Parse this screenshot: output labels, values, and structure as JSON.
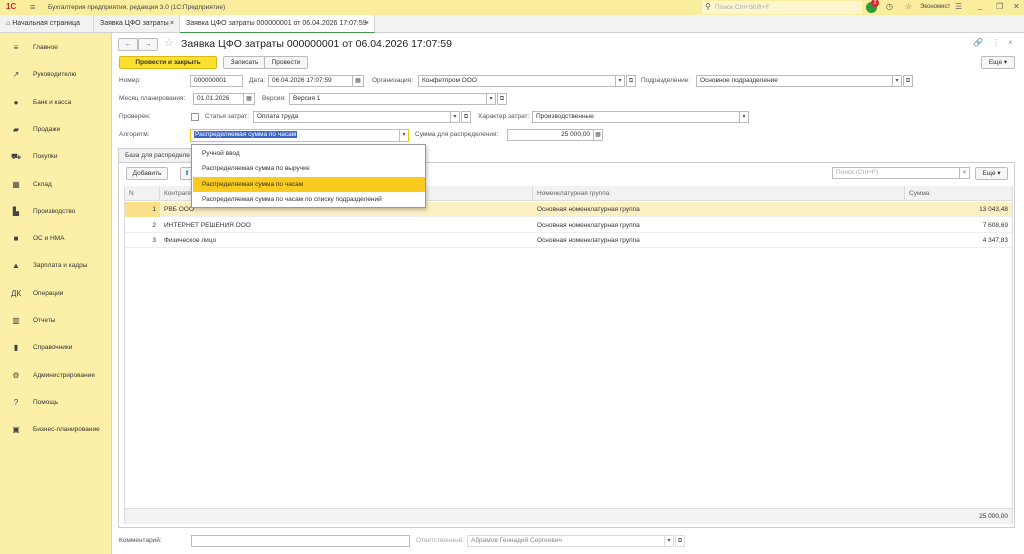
{
  "app": {
    "title": "Бухгалтерия предприятия, редакция 3.0  (1С:Предприятие)",
    "search_placeholder": "Поиск Ctrl+Shift+F",
    "notifications": "2",
    "user": "Экономист"
  },
  "tabs": [
    {
      "label": "Начальная страница"
    },
    {
      "label": "Заявка ЦФО затраты"
    },
    {
      "label": "Заявка ЦФО затраты 000000001 от 06.04.2026 17:07:59"
    }
  ],
  "sidebar": {
    "items": [
      {
        "label": "Главное",
        "icon": "≡"
      },
      {
        "label": "Руководителю",
        "icon": "↗"
      },
      {
        "label": "Банк и касса",
        "icon": "●"
      },
      {
        "label": "Продажи",
        "icon": "▰"
      },
      {
        "label": "Покупки",
        "icon": "⛟"
      },
      {
        "label": "Склад",
        "icon": "▦"
      },
      {
        "label": "Производство",
        "icon": "▙"
      },
      {
        "label": "ОС и НМА",
        "icon": "■"
      },
      {
        "label": "Зарплата и кадры",
        "icon": "▲"
      },
      {
        "label": "Операции",
        "icon": "ДК"
      },
      {
        "label": "Отчеты",
        "icon": "▥"
      },
      {
        "label": "Справочники",
        "icon": "▮"
      },
      {
        "label": "Администрирование",
        "icon": "⚙"
      },
      {
        "label": "Помощь",
        "icon": "?"
      },
      {
        "label": "Бизнес-планирование",
        "icon": "▣"
      }
    ]
  },
  "form": {
    "title": "Заявка ЦФО затраты 000000001 от 06.04.2026 17:07:59",
    "buttons": {
      "post_close": "Провести и закрыть",
      "save": "Записать",
      "post": "Провести",
      "more": "Еще ▾"
    },
    "number_label": "Номер:",
    "number": "000000001",
    "date_label": "Дата:",
    "date": "06.04.2026 17:07:59",
    "org_label": "Организация:",
    "org": "Конфетпром ООО",
    "dept_label": "Подразделение:",
    "dept": "Основное подразделение",
    "month_label": "Месяц планирования:",
    "month": "01.01.2026",
    "version_label": "Версия:",
    "version": "Версия 1",
    "checked_label": "Проверен:",
    "checked": false,
    "cost_item_label": "Статья затрат:",
    "cost_item": "Оплата труда",
    "cost_nature_label": "Характер затрат:",
    "cost_nature": "Производственные",
    "algo_label": "Алгоритм:",
    "algo": "Распределяемая сумма по часам",
    "sum_label": "Сумма для распределения:",
    "sum": "25 000,00",
    "algo_options": [
      "Ручной ввод",
      "Распределяемая сумма по выручке",
      "Распределяемая сумма по часам",
      "Распределяемая сумма по часам по списку подразделений"
    ],
    "algo_selected_index": 2,
    "tab_label": "База для распределе",
    "comment_label": "Комментарий:",
    "comment": "",
    "responsible_label": "Ответственный:",
    "responsible": "Абрамов Геннадий Сергеевич"
  },
  "table": {
    "add": "Добавить",
    "search_placeholder": "Поиск (Ctrl+F)",
    "more": "Еще ▾",
    "columns": [
      "N",
      "Контрагент",
      "Номенклатурная группа",
      "Сумма"
    ],
    "rows": [
      {
        "n": "1",
        "contractor": "РВБ ООО",
        "group": "Основная номенклатурная группа",
        "sum": "13 043,48"
      },
      {
        "n": "2",
        "contractor": "ИНТЕРНЕТ РЕШЕНИЯ ООО",
        "group": "Основная номенклатурная группа",
        "sum": "7 608,69"
      },
      {
        "n": "3",
        "contractor": "Физическое лицо",
        "group": "Основная номенклатурная группа",
        "sum": "4 347,83"
      }
    ],
    "total": "25 000,00"
  },
  "colors": {
    "accent": "#fcdf2f",
    "sidebar": "#fcf0a8",
    "selected_row": "#fdf1c4"
  }
}
